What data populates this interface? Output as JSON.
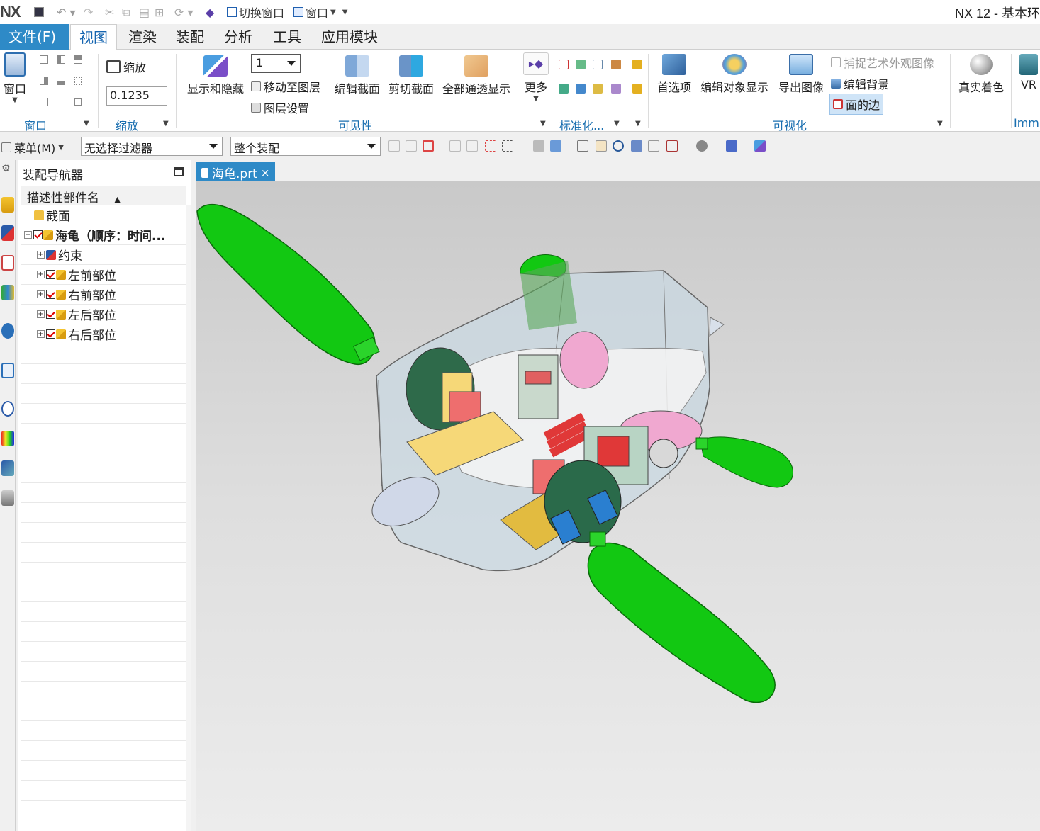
{
  "app": {
    "logo": "NX",
    "title": "NX 12 - 基本环"
  },
  "quick_access": {
    "switch_window": "切换窗口",
    "window": "窗口"
  },
  "tabs": [
    {
      "label": "文件(F)"
    },
    {
      "label": "视图"
    },
    {
      "label": "渲染"
    },
    {
      "label": "装配"
    },
    {
      "label": "分析"
    },
    {
      "label": "工具"
    },
    {
      "label": "应用模块"
    }
  ],
  "ribbon": {
    "window_group": {
      "button": "窗口",
      "label": "窗口"
    },
    "zoom_group": {
      "button": "缩放",
      "value": "0.1235",
      "label": "缩放"
    },
    "visibility_group": {
      "show_hide": "显示和隐藏",
      "layer_value": "1",
      "move_to_layer": "移动至图层",
      "layer_settings": "图层设置",
      "edit_section": "编辑截面",
      "clip_section": "剪切截面",
      "all_transparent": "全部通透显示",
      "more": "更多",
      "label": "可见性"
    },
    "standard_group": {
      "label": "标准化..."
    },
    "visualization_group": {
      "preferences": "首选项",
      "edit_object_display": "编辑对象显示",
      "export_image": "导出图像",
      "capture_art": "捕捉艺术外观图像",
      "edit_background": "编辑背景",
      "face_edges": "面的边",
      "label": "可视化"
    },
    "true_shading": "真实着色",
    "vr": "VR",
    "imm_label": "Imm"
  },
  "cmdbar": {
    "menu": "菜单(M)",
    "filter": "无选择过滤器",
    "scope": "整个装配"
  },
  "navigator": {
    "title": "装配导航器",
    "column_header": "描述性部件名",
    "rows": [
      {
        "label": "截面",
        "level": 0
      },
      {
        "label": "海龟（顺序：时间...",
        "level": 0
      },
      {
        "label": "约束",
        "level": 1
      },
      {
        "label": "左前部位",
        "level": 1
      },
      {
        "label": "右前部位",
        "level": 1
      },
      {
        "label": "左后部位",
        "level": 1
      },
      {
        "label": "右后部位",
        "level": 1
      }
    ]
  },
  "graphics": {
    "tab_label": "海龟.prt",
    "close_glyph": "×"
  },
  "colors": {
    "accent": "#2e8ac7",
    "flipper": "#11cc11",
    "shell": "#c8d8e0"
  }
}
